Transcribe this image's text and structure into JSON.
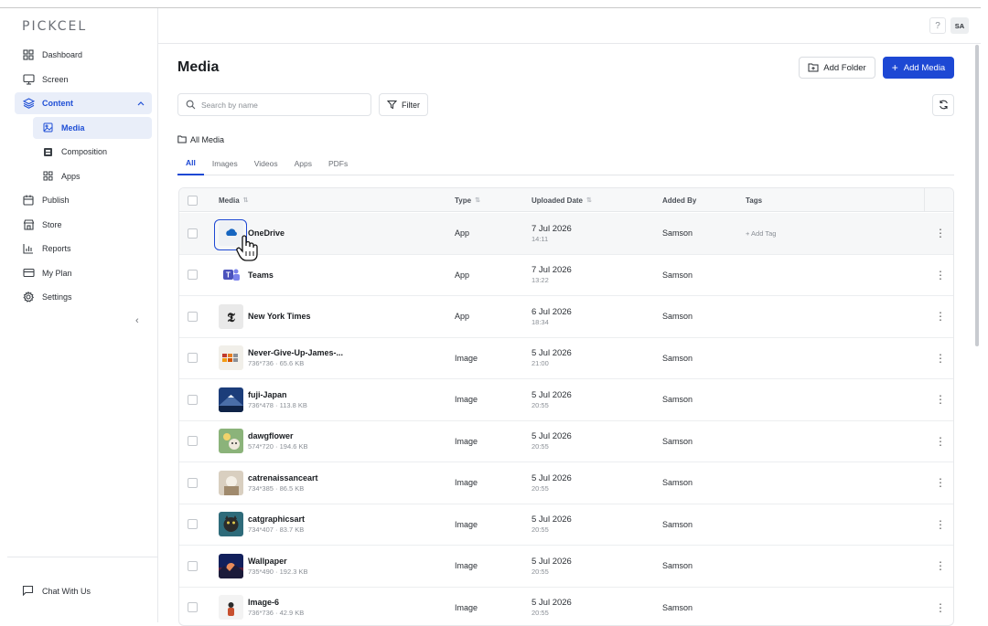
{
  "app": {
    "logo": "PICKCEL"
  },
  "header": {
    "help": "?",
    "avatar": "SA"
  },
  "sidebar": {
    "items": [
      {
        "label": "Dashboard"
      },
      {
        "label": "Screen"
      },
      {
        "label": "Content"
      },
      {
        "label": "Media"
      },
      {
        "label": "Composition"
      },
      {
        "label": "Apps"
      },
      {
        "label": "Publish"
      },
      {
        "label": "Store"
      },
      {
        "label": "Reports"
      },
      {
        "label": "My Plan"
      },
      {
        "label": "Settings"
      }
    ],
    "collapse": "‹",
    "chat": "Chat With Us"
  },
  "main": {
    "title": "Media",
    "add_folder": "Add Folder",
    "add_media": "Add Media",
    "search_placeholder": "Search by name",
    "filter": "Filter",
    "breadcrumb": "All Media",
    "tabs": [
      "All",
      "Images",
      "Videos",
      "Apps",
      "PDFs"
    ]
  },
  "table": {
    "headers": {
      "media": "Media",
      "type": "Type",
      "uploaded": "Uploaded Date",
      "added_by": "Added By",
      "tags": "Tags"
    },
    "rows": [
      {
        "name": "OneDrive",
        "meta": "",
        "type": "App",
        "date": "7 Jul 2026",
        "time": "14:11",
        "by": "Samson",
        "tag": "+ Add Tag"
      },
      {
        "name": "Teams",
        "meta": "",
        "type": "App",
        "date": "7 Jul 2026",
        "time": "13:22",
        "by": "Samson",
        "tag": ""
      },
      {
        "name": "New York Times",
        "meta": "",
        "type": "App",
        "date": "6 Jul 2026",
        "time": "18:34",
        "by": "Samson",
        "tag": ""
      },
      {
        "name": "Never-Give-Up-James-...",
        "meta": "736*736 · 65.6 KB",
        "type": "Image",
        "date": "5 Jul 2026",
        "time": "21:00",
        "by": "Samson",
        "tag": ""
      },
      {
        "name": "fuji-Japan",
        "meta": "736*478 · 113.8 KB",
        "type": "Image",
        "date": "5 Jul 2026",
        "time": "20:55",
        "by": "Samson",
        "tag": ""
      },
      {
        "name": "dawgflower",
        "meta": "574*720 · 194.6 KB",
        "type": "Image",
        "date": "5 Jul 2026",
        "time": "20:55",
        "by": "Samson",
        "tag": ""
      },
      {
        "name": "catrenaissanceart",
        "meta": "734*385 · 86.5 KB",
        "type": "Image",
        "date": "5 Jul 2026",
        "time": "20:55",
        "by": "Samson",
        "tag": ""
      },
      {
        "name": "catgraphicsart",
        "meta": "734*407 · 83.7 KB",
        "type": "Image",
        "date": "5 Jul 2026",
        "time": "20:55",
        "by": "Samson",
        "tag": ""
      },
      {
        "name": "Wallpaper",
        "meta": "735*490 · 192.3 KB",
        "type": "Image",
        "date": "5 Jul 2026",
        "time": "20:55",
        "by": "Samson",
        "tag": ""
      },
      {
        "name": "Image-6",
        "meta": "736*736 · 42.9 KB",
        "type": "Image",
        "date": "5 Jul 2026",
        "time": "20:55",
        "by": "Samson",
        "tag": ""
      }
    ]
  },
  "colors": {
    "accent": "#1d48d4",
    "active_bg": "#e9eef9"
  }
}
